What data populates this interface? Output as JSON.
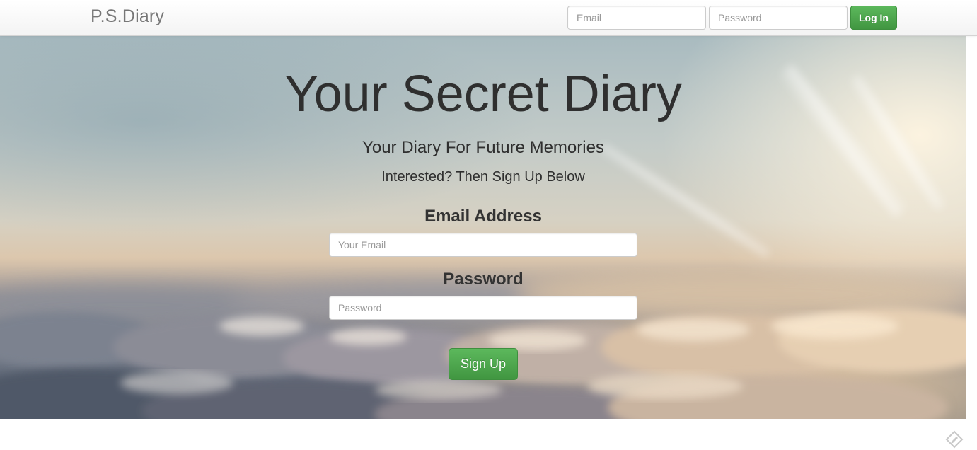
{
  "navbar": {
    "brand": "P.S.Diary",
    "email_placeholder": "Email",
    "password_placeholder": "Password",
    "login_label": "Log In"
  },
  "hero": {
    "title": "Your Secret Diary",
    "subtitle": "Your Diary For Future Memories",
    "cta": "Interested? Then Sign Up Below",
    "email_label": "Email Address",
    "email_placeholder": "Your Email",
    "password_label": "Password",
    "password_placeholder": "Password",
    "signup_label": "Sign Up"
  },
  "corner": {
    "icon": "diamond-pencil-icon"
  },
  "colors": {
    "success": "#5cb85c",
    "heading": "#2f2f2f",
    "brand": "#777777"
  }
}
